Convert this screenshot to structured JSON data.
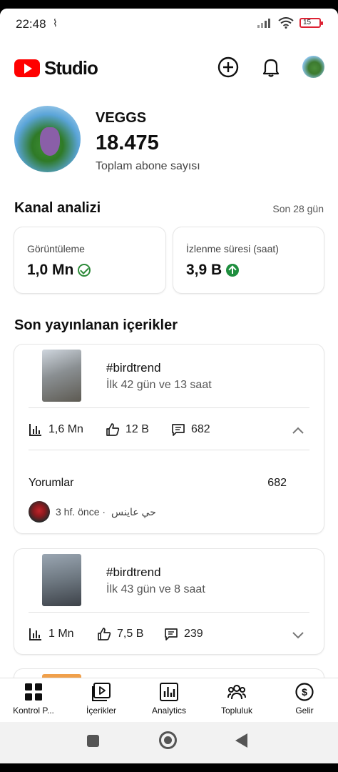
{
  "status_bar": {
    "time": "22:48",
    "extra": "⌇",
    "battery": "15"
  },
  "app": {
    "logo_text": "Studio"
  },
  "channel": {
    "name": "VEGGS",
    "subscribers": "18.475",
    "subscribers_label": "Toplam abone sayısı"
  },
  "analytics": {
    "title": "Kanal analizi",
    "period": "Son 28 gün",
    "views": {
      "label": "Görüntüleme",
      "value": "1,0 Mn"
    },
    "watch_time": {
      "label": "İzlenme süresi (saat)",
      "value": "3,9 B"
    }
  },
  "recent": {
    "title": "Son yayınlanan içerikler",
    "videos": [
      {
        "title": "#birdtrend",
        "subtitle": "İlk 42 gün ve 13 saat",
        "views": "1,6 Mn",
        "likes": "12 B",
        "comments": "682",
        "comments_label": "Yorumlar",
        "comments_count": "682",
        "latest_comment_time": "3 hf. önce ·",
        "latest_comment_author": "حي عاينس"
      },
      {
        "title": "#birdtrend",
        "subtitle": "İlk 43 gün ve 8 saat",
        "views": "1 Mn",
        "likes": "7,5 B",
        "comments": "239"
      }
    ]
  },
  "bottom_nav": [
    "Kontrol P...",
    "İçerikler",
    "Analytics",
    "Topluluk",
    "Gelir"
  ]
}
